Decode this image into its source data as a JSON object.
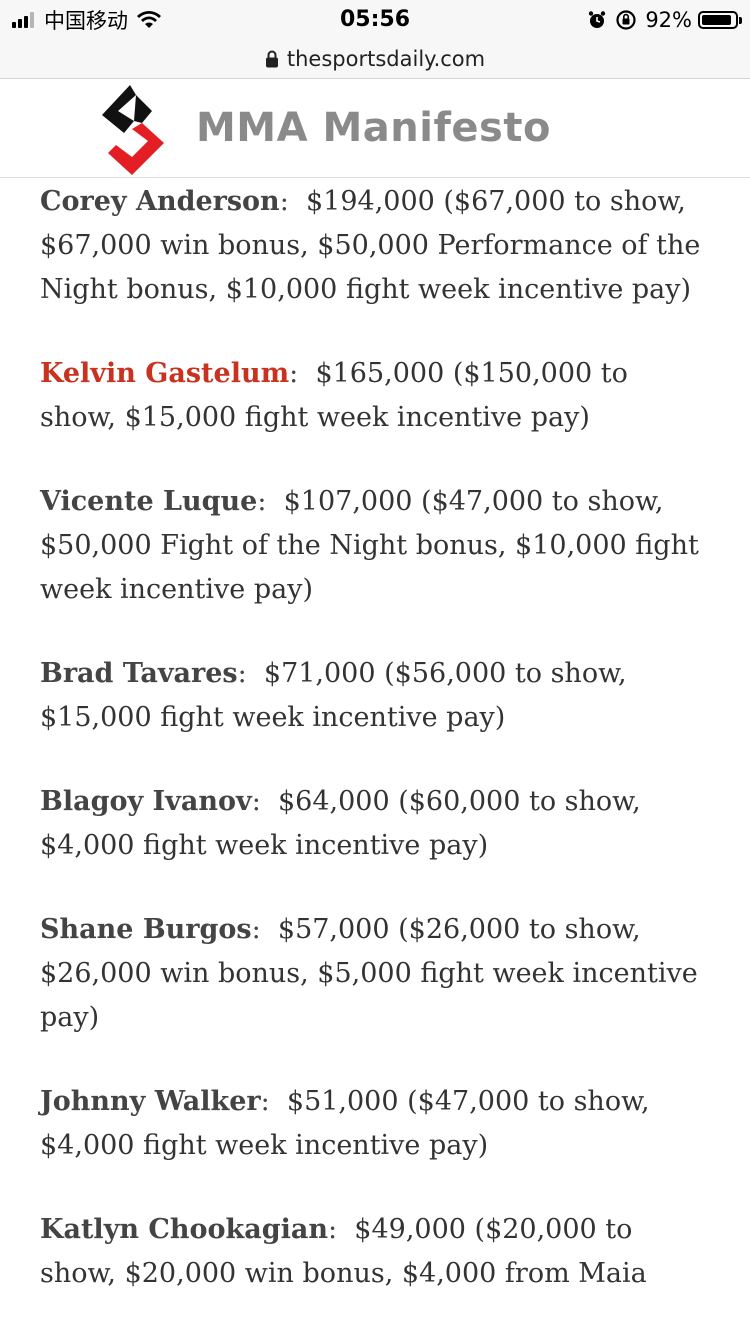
{
  "status_bar": {
    "carrier": "中国移动",
    "time": "05:56",
    "battery_percent": "92%",
    "battery_level": 0.92
  },
  "browser": {
    "url": "thesportsdaily.com"
  },
  "site": {
    "brand": "MMA Manifesto",
    "logo_colors": {
      "dark": "#111111",
      "red": "#e31e24"
    }
  },
  "entries": [
    {
      "name": "Corey Anderson",
      "is_link": false,
      "detail": "$194,000 ($67,000 to show, $67,000 win bonus, $50,000 Performance of the Night bonus, $10,000 fight week incentive pay)"
    },
    {
      "name": "Kelvin Gastelum",
      "is_link": true,
      "detail": "$165,000 ($150,000 to show, $15,000 fight week incentive pay)"
    },
    {
      "name": "Vicente Luque",
      "is_link": false,
      "detail": "$107,000 ($47,000 to show, $50,000 Fight of the Night bonus, $10,000 fight week incentive pay)"
    },
    {
      "name": "Brad Tavares",
      "is_link": false,
      "detail": "$71,000 ($56,000 to show, $15,000 fight week incentive pay)"
    },
    {
      "name": "Blagoy Ivanov",
      "is_link": false,
      "detail": "$64,000 ($60,000 to show, $4,000 fight week incentive pay)"
    },
    {
      "name": "Shane Burgos",
      "is_link": false,
      "detail": "$57,000 ($26,000 to show, $26,000 win bonus, $5,000 fight week incentive pay)"
    },
    {
      "name": "Johnny Walker",
      "is_link": false,
      "detail": "$51,000 ($47,000 to show, $4,000 fight week incentive pay)"
    },
    {
      "name": "Katlyn Chookagian",
      "is_link": false,
      "detail": "$49,000 ($20,000 to show, $20,000 win bonus, $4,000 from Maia"
    }
  ],
  "colors": {
    "link_red": "#c8321e",
    "body_text": "#333333",
    "brand_gray": "#8a8a8a"
  }
}
